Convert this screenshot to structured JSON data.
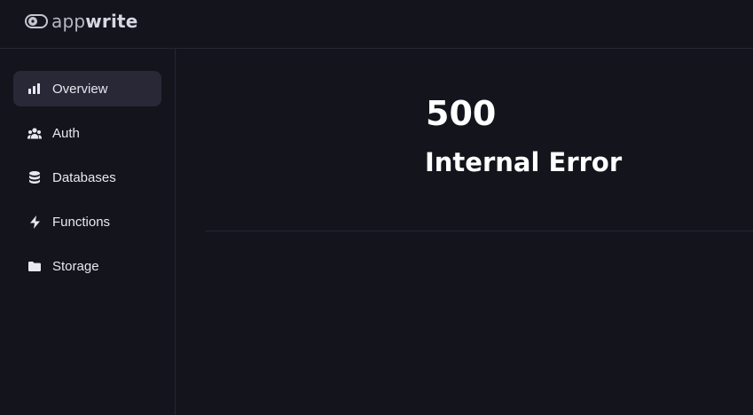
{
  "app": {
    "logo_light": "app",
    "logo_bold": "write"
  },
  "sidebar": {
    "items": [
      {
        "label": "Overview",
        "icon": "bar-chart-icon",
        "active": true
      },
      {
        "label": "Auth",
        "icon": "users-icon",
        "active": false
      },
      {
        "label": "Databases",
        "icon": "database-icon",
        "active": false
      },
      {
        "label": "Functions",
        "icon": "lightning-icon",
        "active": false
      },
      {
        "label": "Storage",
        "icon": "folder-icon",
        "active": false
      }
    ]
  },
  "error": {
    "code": "500",
    "message": "Internal Error"
  },
  "colors": {
    "background": "#14141d",
    "active_item": "#282836",
    "border": "#262633",
    "text": "#ffffff"
  }
}
